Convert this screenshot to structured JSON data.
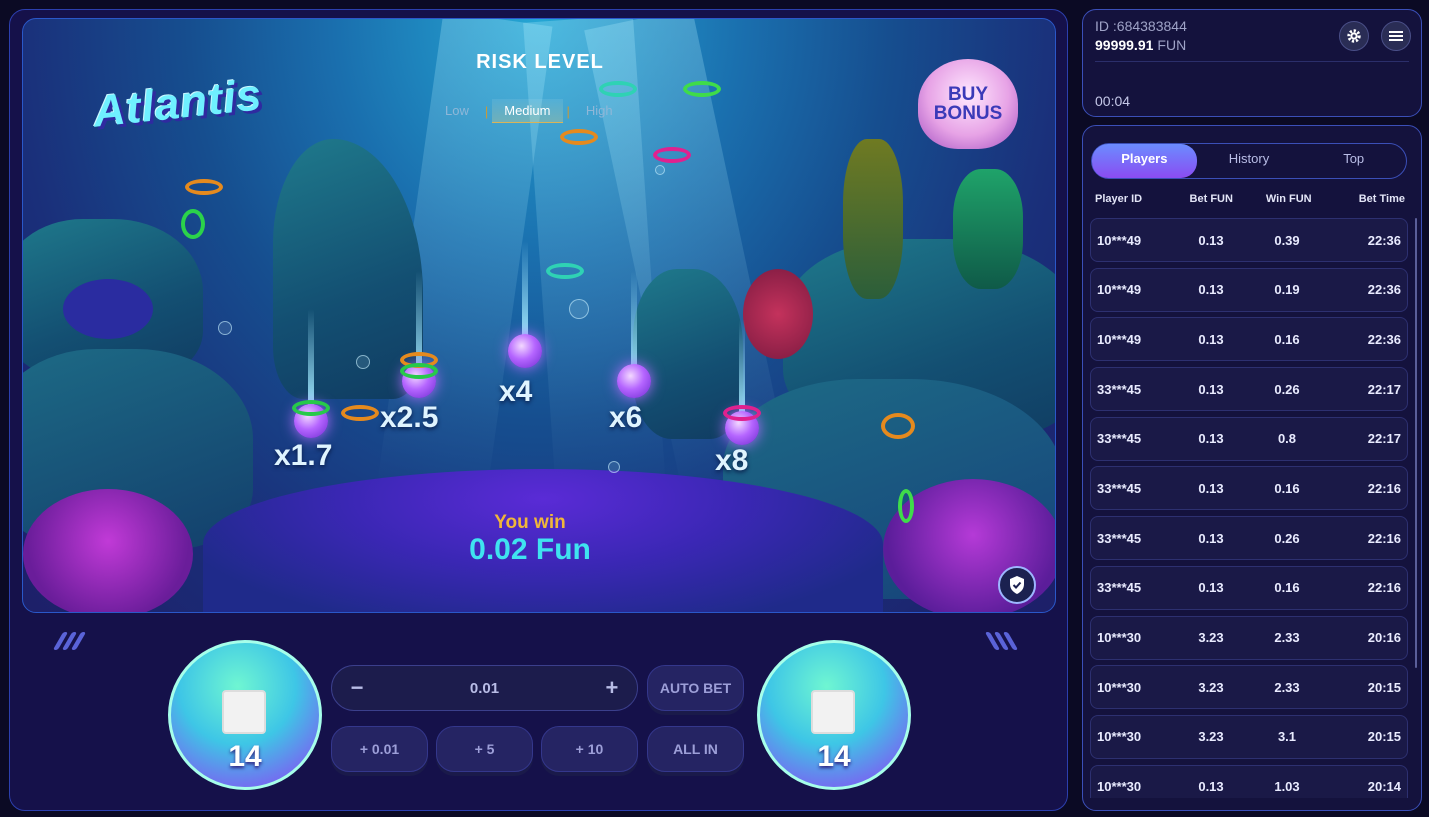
{
  "game": {
    "logo_text": "Atlantis",
    "risk": {
      "title": "RISK LEVEL",
      "options": [
        "Low",
        "Medium",
        "High"
      ],
      "selected": "Medium"
    },
    "buy_bonus": [
      "BUY",
      "BONUS"
    ],
    "multipliers": [
      "x1.7",
      "x2.5",
      "x4",
      "x6",
      "x8"
    ],
    "win_label": "You win",
    "win_value": "0.02 Fun"
  },
  "controls": {
    "bet_value": "0.01",
    "minus_symbol": "−",
    "plus_symbol": "+",
    "auto_bet": "AUTO BET",
    "quick_bets": [
      "+ 0.01",
      "+ 5",
      "+ 10",
      "ALL IN"
    ],
    "drum_left": "14",
    "drum_right": "14"
  },
  "account": {
    "id": "ID :684383844",
    "balance": "99999.91",
    "currency": "FUN",
    "timer": "00:04"
  },
  "panel": {
    "tabs": [
      "Players",
      "History",
      "Top"
    ],
    "active_tab": "Players",
    "headers": [
      "Player ID",
      "Bet  FUN",
      "Win  FUN",
      "Bet Time"
    ],
    "rows": [
      [
        "10***49",
        "0.13",
        "0.39",
        "22:36"
      ],
      [
        "10***49",
        "0.13",
        "0.19",
        "22:36"
      ],
      [
        "10***49",
        "0.13",
        "0.16",
        "22:36"
      ],
      [
        "33***45",
        "0.13",
        "0.26",
        "22:17"
      ],
      [
        "33***45",
        "0.13",
        "0.8",
        "22:17"
      ],
      [
        "33***45",
        "0.13",
        "0.16",
        "22:16"
      ],
      [
        "33***45",
        "0.13",
        "0.26",
        "22:16"
      ],
      [
        "33***45",
        "0.13",
        "0.16",
        "22:16"
      ],
      [
        "10***30",
        "3.23",
        "2.33",
        "20:16"
      ],
      [
        "10***30",
        "3.23",
        "2.33",
        "20:15"
      ],
      [
        "10***30",
        "3.23",
        "3.1",
        "20:15"
      ],
      [
        "10***30",
        "0.13",
        "1.03",
        "20:14"
      ]
    ]
  },
  "colors": {
    "accent_cyan": "#3fe3f0",
    "win_gold": "#f0b63a",
    "border_blue": "#3b4fb8",
    "tab_gradient_start": "#6b8cff",
    "tab_gradient_end": "#8a4cf2"
  },
  "icons": {
    "settings": "gear-icon",
    "menu": "hamburger-menu-icon",
    "fairness": "shield-check-icon"
  }
}
